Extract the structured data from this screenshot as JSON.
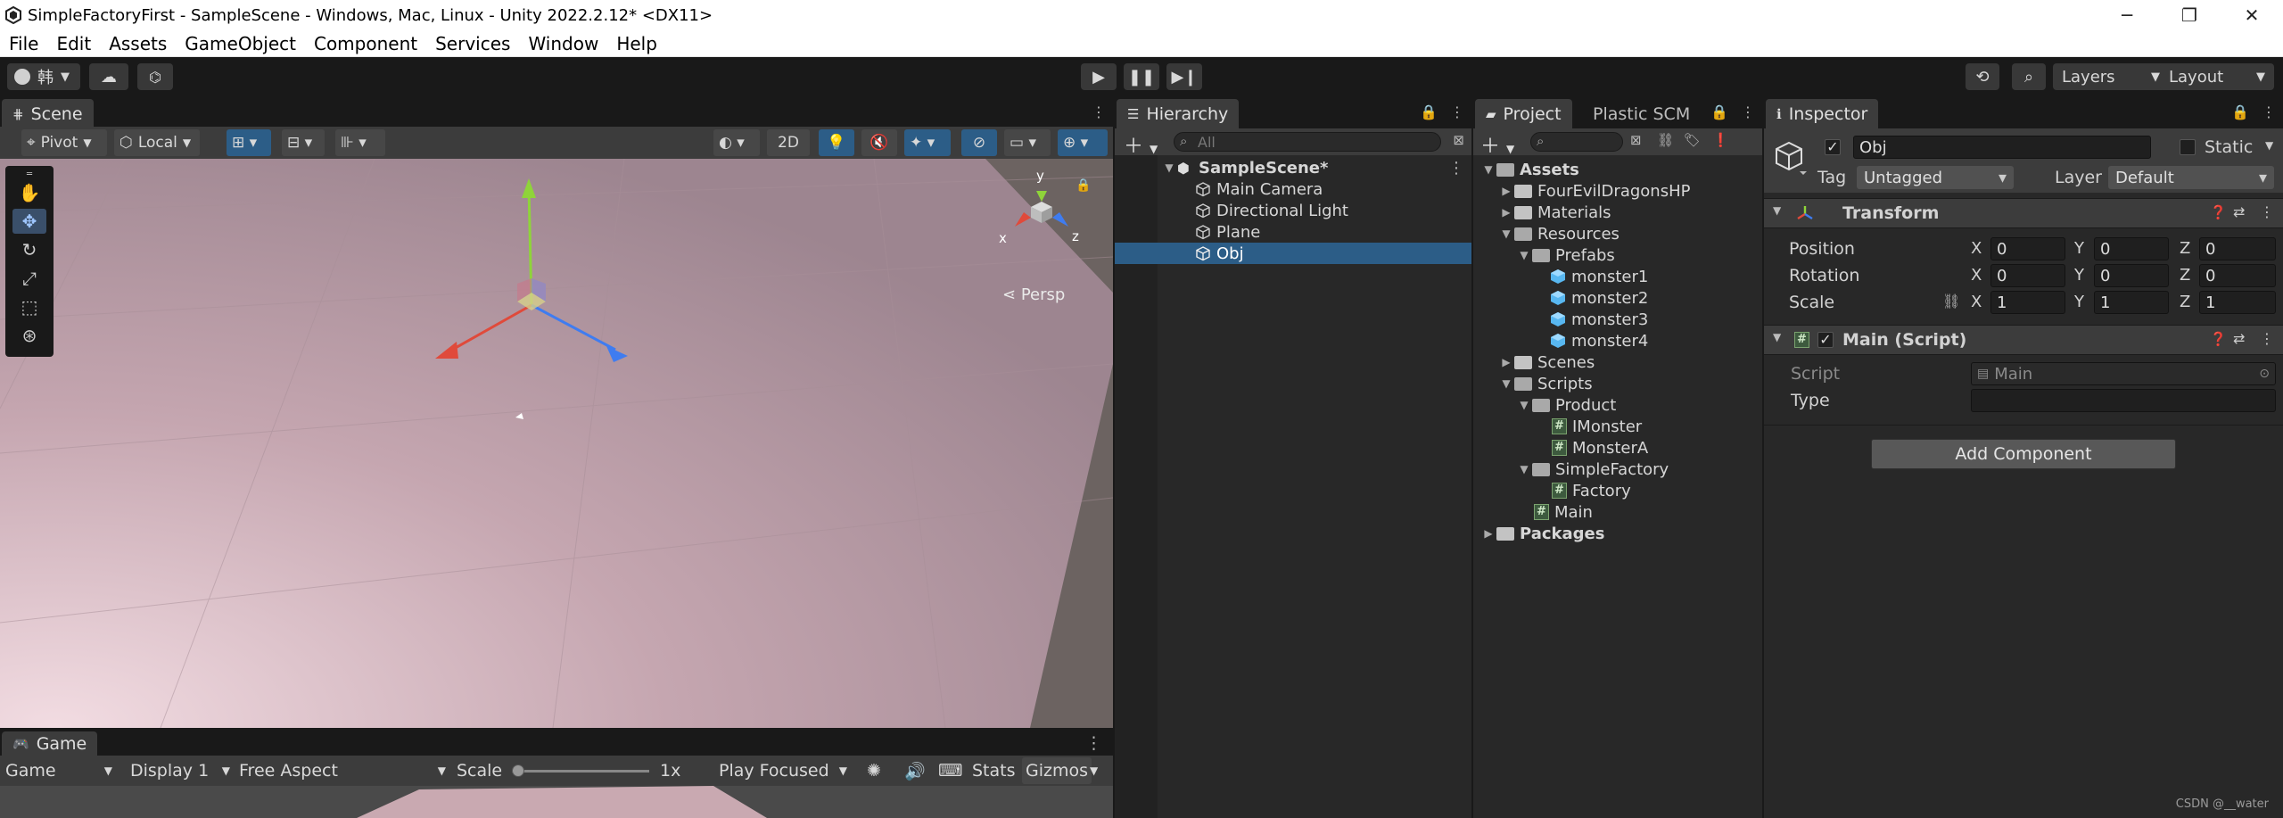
{
  "window": {
    "title": "SimpleFactoryFirst - SampleScene - Windows, Mac, Linux - Unity 2022.2.12* <DX11>",
    "controls": [
      "─",
      "❐",
      "✕"
    ]
  },
  "menu": [
    "File",
    "Edit",
    "Assets",
    "GameObject",
    "Component",
    "Services",
    "Window",
    "Help"
  ],
  "toolbar": {
    "account_label": "韩",
    "layers_label": "Layers",
    "layout_label": "Layout"
  },
  "scene": {
    "tab_label": "Scene",
    "pivot_label": "Pivot",
    "local_label": "Local",
    "mode_2d_label": "2D",
    "persp_label": "Persp",
    "gizmo_axes": [
      "y",
      "x",
      "z"
    ]
  },
  "game": {
    "tab_label": "Game",
    "mode_label": "Game",
    "display_label": "Display 1",
    "aspect_label": "Free Aspect",
    "scale_label": "Scale",
    "scale_value": "1x",
    "scale_fraction": 0.0,
    "play_focused_label": "Play Focused",
    "stats_label": "Stats",
    "gizmos_label": "Gizmos"
  },
  "hierarchy": {
    "tab_label": "Hierarchy",
    "search_placeholder": "All",
    "scene_name": "SampleScene*",
    "items": [
      "Main Camera",
      "Directional Light",
      "Plane",
      "Obj"
    ],
    "selected": "Obj"
  },
  "project": {
    "tab_label": "Project",
    "tab2_label": "Plastic SCM",
    "tree": {
      "assets": "Assets",
      "fourevil": "FourEvilDragonsHP",
      "materials": "Materials",
      "resources": "Resources",
      "prefabs": "Prefabs",
      "monsters": [
        "monster1",
        "monster2",
        "monster3",
        "monster4"
      ],
      "scenes": "Scenes",
      "scripts": "Scripts",
      "product": "Product",
      "imonster": "IMonster",
      "monstera": "MonsterA",
      "simplefactory": "SimpleFactory",
      "factory": "Factory",
      "main": "Main",
      "packages": "Packages"
    }
  },
  "inspector": {
    "tab_label": "Inspector",
    "object_name": "Obj",
    "static_label": "Static",
    "tag_label": "Tag",
    "tag_value": "Untagged",
    "layer_label": "Layer",
    "layer_value": "Default",
    "transform": {
      "title": "Transform",
      "position_label": "Position",
      "rotation_label": "Rotation",
      "scale_label": "Scale",
      "position": [
        "0",
        "0",
        "0"
      ],
      "rotation": [
        "0",
        "0",
        "0"
      ],
      "scale": [
        "1",
        "1",
        "1"
      ],
      "axis_labels": [
        "X",
        "Y",
        "Z"
      ]
    },
    "script": {
      "title": "Main (Script)",
      "script_label": "Script",
      "script_value": "Main",
      "type_label": "Type",
      "type_value": ""
    },
    "add_component_label": "Add Component"
  },
  "watermark": "CSDN @__water",
  "colors": {
    "selection": "#2c5d87",
    "panel_bg": "#282828",
    "axis_x": "#e04a3b",
    "axis_y": "#8fd43a",
    "axis_z": "#3f7cf0"
  }
}
